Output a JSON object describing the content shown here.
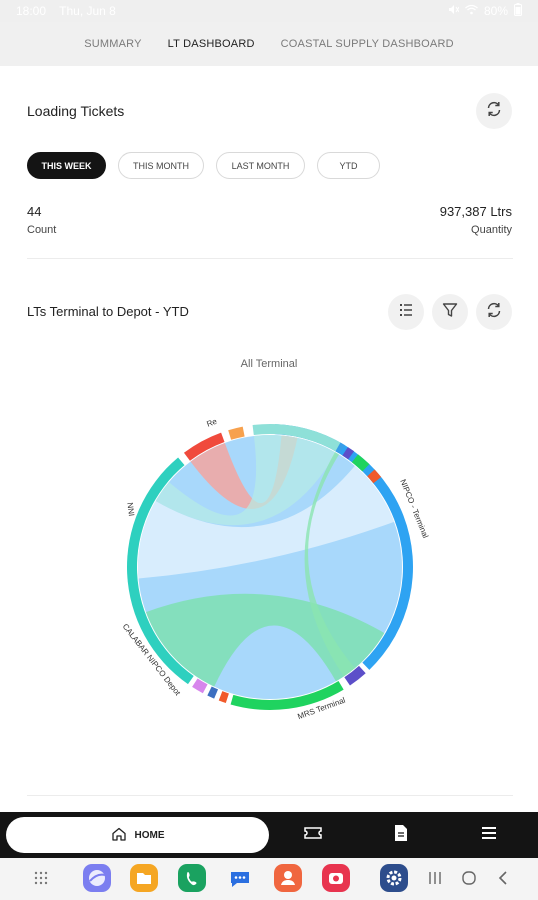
{
  "status": {
    "time": "18:00",
    "date": "Thu, Jun 8",
    "battery": "80%"
  },
  "tabs": [
    {
      "label": "SUMMARY",
      "active": false
    },
    {
      "label": "LT DASHBOARD",
      "active": true
    },
    {
      "label": "COASTAL SUPPLY DASHBOARD",
      "active": false
    }
  ],
  "loading": {
    "title": "Loading Tickets",
    "filters": [
      "THIS WEEK",
      "THIS MONTH",
      "LAST MONTH",
      "YTD"
    ],
    "active_filter": "THIS WEEK",
    "count_value": "44",
    "count_label": "Count",
    "quantity_value": "937,387 Ltrs",
    "quantity_label": "Quantity"
  },
  "chord_card": {
    "title": "LTs Terminal to Depot - YTD",
    "caption": "All Terminal"
  },
  "chart_data": {
    "type": "chord",
    "title": "All Terminal",
    "nodes": [
      {
        "name": "NIPCO - Terminal",
        "color": "#2ea3f2"
      },
      {
        "name": "",
        "color": "#5c4fc9"
      },
      {
        "name": "MRS Terminal",
        "color": "#1fd35f"
      },
      {
        "name": "",
        "color": "#f15a2b"
      },
      {
        "name": "",
        "color": "#3d6fc0"
      },
      {
        "name": "",
        "color": "#d786ec"
      },
      {
        "name": "CALABAR NIPCO Depot",
        "color": "#2ed0bf"
      },
      {
        "name": "",
        "color": "#f04a3c"
      },
      {
        "name": "",
        "color": "#f7a14e"
      },
      {
        "name": "",
        "color": "#8ee0d8"
      },
      {
        "name": "",
        "color": "#3a9ee8"
      },
      {
        "name": "",
        "color": "#5c4fc9"
      },
      {
        "name": "",
        "color": "#1fd35f"
      },
      {
        "name": "",
        "color": "#f15a2b"
      }
    ],
    "node_labels": {
      "small_left": "NNI",
      "small_top": "Re"
    },
    "links": [
      {
        "source": "NIPCO - Terminal",
        "target": "CALABAR NIPCO Depot"
      },
      {
        "source": "NIPCO - Terminal",
        "target": "CALABAR NIPCO Depot"
      },
      {
        "source": "MRS Terminal",
        "target": "CALABAR NIPCO Depot"
      }
    ]
  },
  "bottom_nav": {
    "home_label": "HOME"
  }
}
